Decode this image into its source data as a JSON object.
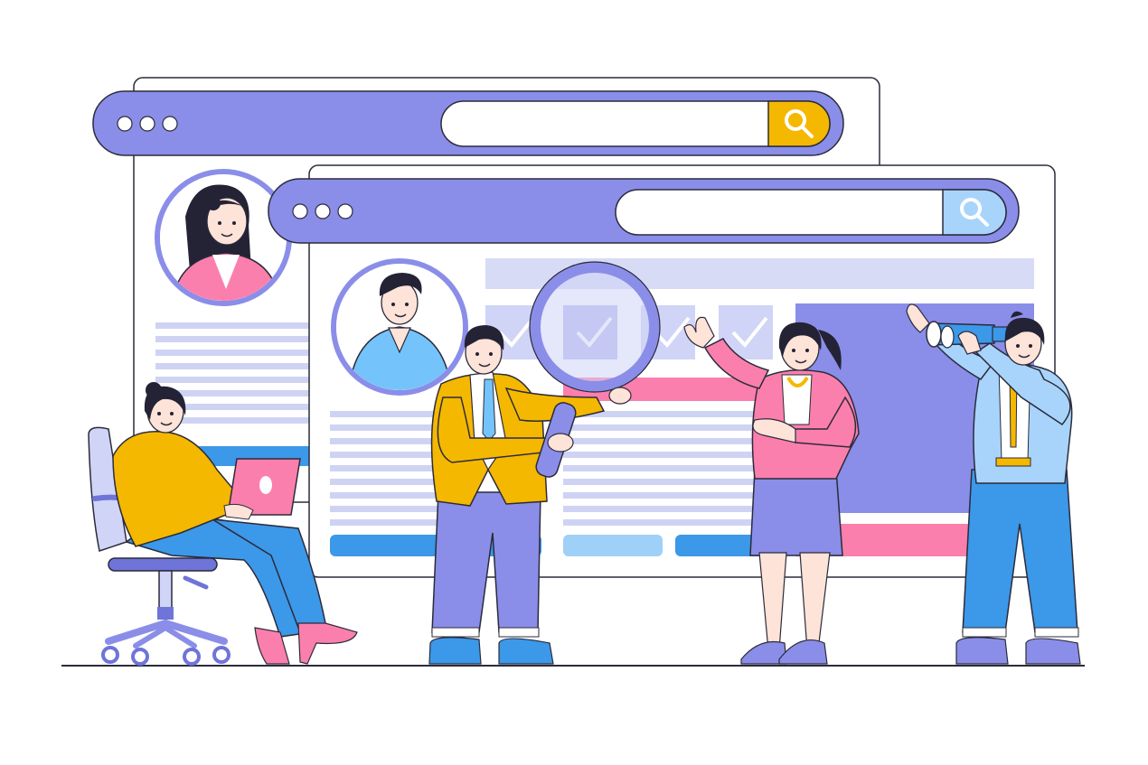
{
  "palette": {
    "background": "#ffffff",
    "window_frame": "#e6e8f2",
    "window_stroke": "#2b2b3b",
    "toolbar": "#8a8ee8",
    "toolbar_dark": "#6f74d8",
    "search_field": "#ffffff",
    "search_button_back": "#f5b800",
    "search_button_front": "#a8d4fb",
    "placeholder_light": "#d8dbf6",
    "placeholder_line": "#cfd3f3",
    "check_tile": "#d0d4f6",
    "check_tile_active": "#b5bbef",
    "accent_pink": "#fb7fac",
    "accent_blue": "#3c98e8",
    "accent_light_blue": "#9ed0f8",
    "panel_purple": "#8a8ee8",
    "skin": "#fde3d8",
    "hair": "#242235",
    "ground": "#2b2b3b"
  },
  "icons": {
    "back_search": "magnifier-icon",
    "front_search": "magnifier-icon",
    "window_dots": "three-dots-icon",
    "check": "checkmark-icon",
    "magnifying_glass": "magnifying-glass-icon",
    "binoculars": "binoculars-icon",
    "laptop": "laptop-icon",
    "office_chair": "office-chair-icon"
  },
  "scene": {
    "back_window": {
      "checks": 0
    },
    "front_window": {
      "check_count": 4,
      "checked": [
        true,
        true,
        true,
        true
      ]
    },
    "people": [
      "woman-with-laptop",
      "man-with-magnifier",
      "woman-presenting",
      "man-with-binoculars"
    ]
  }
}
